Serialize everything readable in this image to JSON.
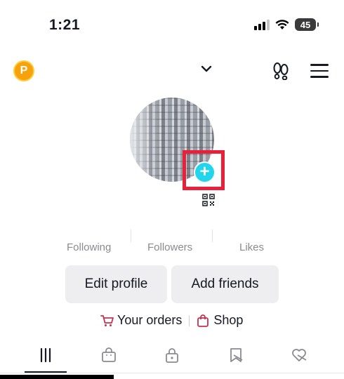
{
  "status_bar": {
    "time": "1:21",
    "battery": "45"
  },
  "header": {
    "coin_letter": "P"
  },
  "stats": {
    "following_label": "Following",
    "followers_label": "Followers",
    "likes_label": "Likes"
  },
  "actions": {
    "edit_profile": "Edit profile",
    "add_friends": "Add friends"
  },
  "links": {
    "orders": "Your orders",
    "shop": "Shop"
  },
  "tabs": [
    {
      "icon": "grid-icon",
      "active": true
    },
    {
      "icon": "shopping-bag-icon",
      "active": false
    },
    {
      "icon": "lock-icon",
      "active": false
    },
    {
      "icon": "bookmark-hidden-icon",
      "active": false
    },
    {
      "icon": "heart-hidden-icon",
      "active": false
    }
  ],
  "colors": {
    "accent": "#e8203a",
    "add_button": "#20d5ec",
    "coin": "#f7a20c",
    "shop_icon": "#c9304f"
  }
}
